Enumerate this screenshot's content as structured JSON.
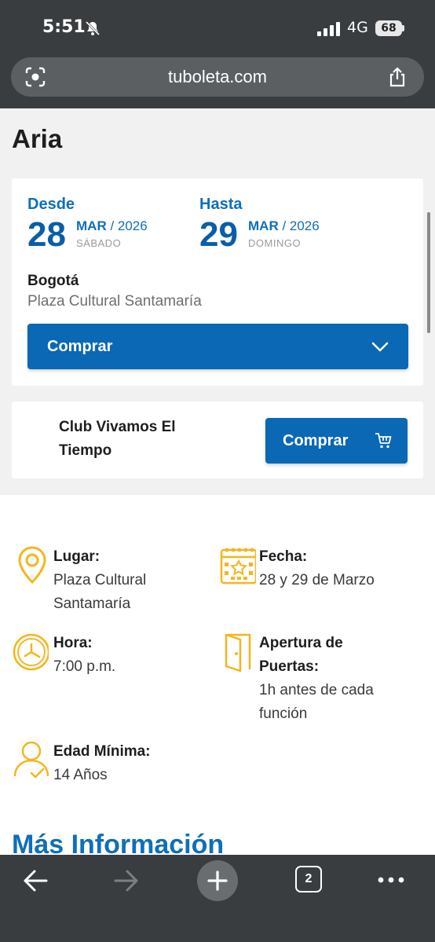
{
  "status_bar": {
    "time": "5:51",
    "network": "4G",
    "battery": "68",
    "icons": [
      "bell-muted-icon",
      "signal-icon"
    ]
  },
  "browser": {
    "url": "tuboleta.com",
    "icons": [
      "lens-icon",
      "share-icon"
    ]
  },
  "event": {
    "title": "Aria",
    "from": {
      "label": "Desde",
      "day": "28",
      "month": "MAR",
      "year": "/ 2026",
      "weekday": "SÁBADO"
    },
    "to": {
      "label": "Hasta",
      "day": "29",
      "month": "MAR",
      "year": "/ 2026",
      "weekday": "DOMINGO"
    },
    "city": "Bogotá",
    "venue": "Plaza Cultural Santamaría",
    "buy_label": "Comprar"
  },
  "club": {
    "name": "Club Vivamos El Tiempo",
    "buy_label": "Comprar"
  },
  "info": {
    "lugar": {
      "label": "Lugar:",
      "value": "Plaza Cultural Santamaría",
      "icon": "location-pin-icon"
    },
    "fecha": {
      "label": "Fecha:",
      "value": "28 y 29 de Marzo",
      "icon": "calendar-icon"
    },
    "hora": {
      "label": "Hora:",
      "value": "7:00 p.m.",
      "icon": "clock-icon"
    },
    "apertura": {
      "label": "Apertura de Puertas:",
      "value": "1h antes de cada función",
      "icon": "door-icon"
    },
    "edad": {
      "label": "Edad Mínima:",
      "value": "14 Años",
      "icon": "person-check-icon"
    }
  },
  "more_info_heading": "Más Información",
  "toolbar": {
    "tab_count": "2",
    "icons": [
      "back-arrow-icon",
      "forward-arrow-icon",
      "plus-icon",
      "more-dots-icon"
    ]
  },
  "colors": {
    "accent": "#0a68b4",
    "icon_yellow": "#f5b51e",
    "chrome": "#3a3d40"
  }
}
